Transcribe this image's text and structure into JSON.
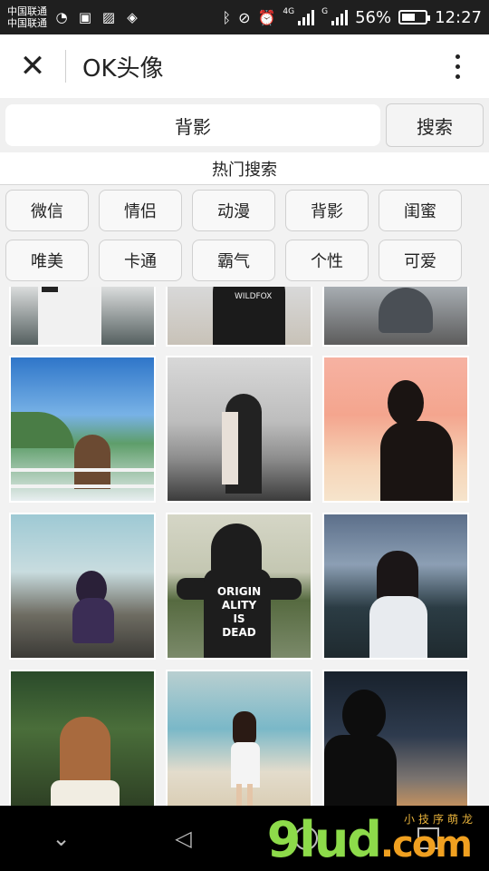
{
  "status_bar": {
    "carrier_1": "中国联通",
    "carrier_2": "中国联通",
    "network_tag": "4G",
    "network_tag_2": "G",
    "battery_percent": "56%",
    "battery_level": 0.56,
    "time": "12:27",
    "icons": [
      "qq-icon",
      "lock-icon",
      "image-icon",
      "shield-icon",
      "bluetooth-icon",
      "mute-icon",
      "alarm-icon"
    ]
  },
  "app_bar": {
    "close_icon": "close-icon",
    "title": "OK头像",
    "menu_icon": "more-vertical-icon"
  },
  "search": {
    "value": "背影",
    "button_label": "搜索"
  },
  "hot_search": {
    "title": "热门搜索",
    "tags": [
      "微信",
      "情侣",
      "动漫",
      "背影",
      "闺蜜",
      "唯美",
      "卡通",
      "霸气",
      "个性",
      "可爱"
    ]
  },
  "grid": {
    "image_count": 12,
    "partial_text": [
      "WILDFOX",
      "ORIGIN ALITY IS DEAD"
    ]
  },
  "nav_bar": {
    "back_icon": "back-icon",
    "home_icon": "home-icon",
    "recent_icon": "recent-apps-icon",
    "hide_icon": "chevron-down-icon"
  },
  "watermark": {
    "text": "9lud",
    "suffix": ".com",
    "sub_text": "小技序萌龙"
  }
}
